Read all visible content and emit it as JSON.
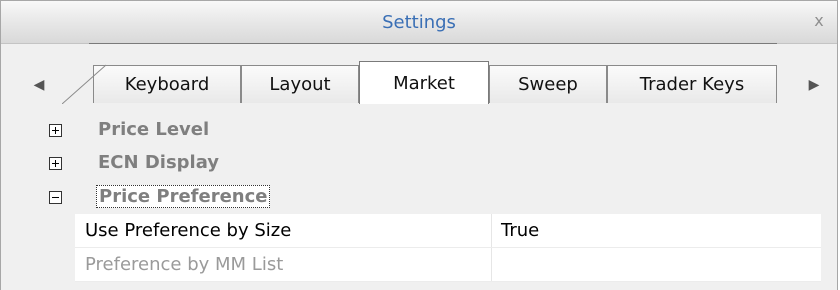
{
  "window": {
    "title": "Settings",
    "close_label": "x"
  },
  "tabs": [
    {
      "label": "Keyboard",
      "active": false
    },
    {
      "label": "Layout",
      "active": false
    },
    {
      "label": "Market",
      "active": true
    },
    {
      "label": "Sweep",
      "active": false
    },
    {
      "label": "Trader Keys",
      "active": false
    }
  ],
  "nav": {
    "left_arrow": "◀",
    "right_arrow": "▶"
  },
  "groups": [
    {
      "label": "Price Level",
      "expanded": false
    },
    {
      "label": "ECN Display",
      "expanded": false
    },
    {
      "label": "Price Preference",
      "expanded": true
    }
  ],
  "properties": [
    {
      "name": "Use Preference by Size",
      "value": "True",
      "enabled": true
    },
    {
      "name": "Preference by MM List",
      "value": "",
      "enabled": false
    }
  ],
  "colors": {
    "title": "#3a6fb5",
    "group_label": "#7f7f7f",
    "disabled_text": "#9a9a9a"
  }
}
